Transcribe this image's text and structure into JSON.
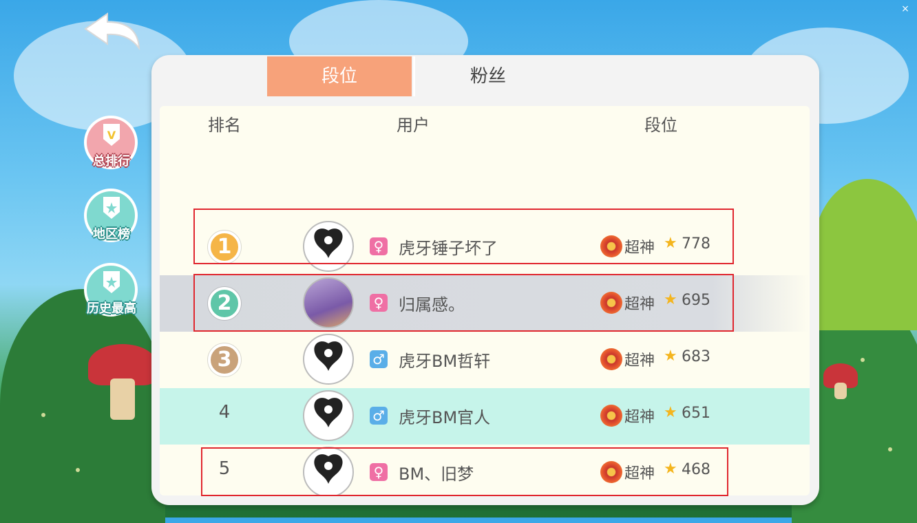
{
  "window": {
    "close_label": "×"
  },
  "side_tabs": [
    {
      "label": "总排行",
      "color": "#f2a6ad"
    },
    {
      "label": "地区榜",
      "color": "#7fd9cf"
    },
    {
      "label": "历史最高",
      "color": "#7fd9cf"
    }
  ],
  "tabs": [
    {
      "label": "段位",
      "active": true
    },
    {
      "label": "粉丝",
      "active": false
    }
  ],
  "columns": {
    "rank": "排名",
    "user": "用户",
    "tier": "段位"
  },
  "rows": [
    {
      "rank": "1",
      "medal": "gold",
      "gender": "♀",
      "gender_type": "female",
      "name": "虎牙锤子坏了",
      "tier": "超神",
      "star": "★",
      "score": "778",
      "highlight": "none",
      "boxed": true
    },
    {
      "rank": "2",
      "medal": "green",
      "gender": "♀",
      "gender_type": "female",
      "name": "归属感。",
      "tier": "超神",
      "star": "★",
      "score": "695",
      "highlight": "selected",
      "boxed": true
    },
    {
      "rank": "3",
      "medal": "bronze",
      "gender": "♂",
      "gender_type": "male",
      "name": "虎牙BM哲轩",
      "tier": "超神",
      "star": "★",
      "score": "683",
      "highlight": "none",
      "boxed": false
    },
    {
      "rank": "4",
      "medal": "none",
      "gender": "♂",
      "gender_type": "male",
      "name": "虎牙BM官人",
      "tier": "超神",
      "star": "★",
      "score": "651",
      "highlight": "mint",
      "boxed": false
    },
    {
      "rank": "5",
      "medal": "none",
      "gender": "♀",
      "gender_type": "female",
      "name": "BM、旧梦",
      "tier": "超神",
      "star": "★",
      "score": "468",
      "highlight": "none",
      "boxed": true
    }
  ],
  "colors": {
    "tab_active": "#f7a27a",
    "highlight_mint": "#c6f4ea",
    "highlight_selected": "#d6d9de",
    "annotation_box": "#e0262e"
  }
}
